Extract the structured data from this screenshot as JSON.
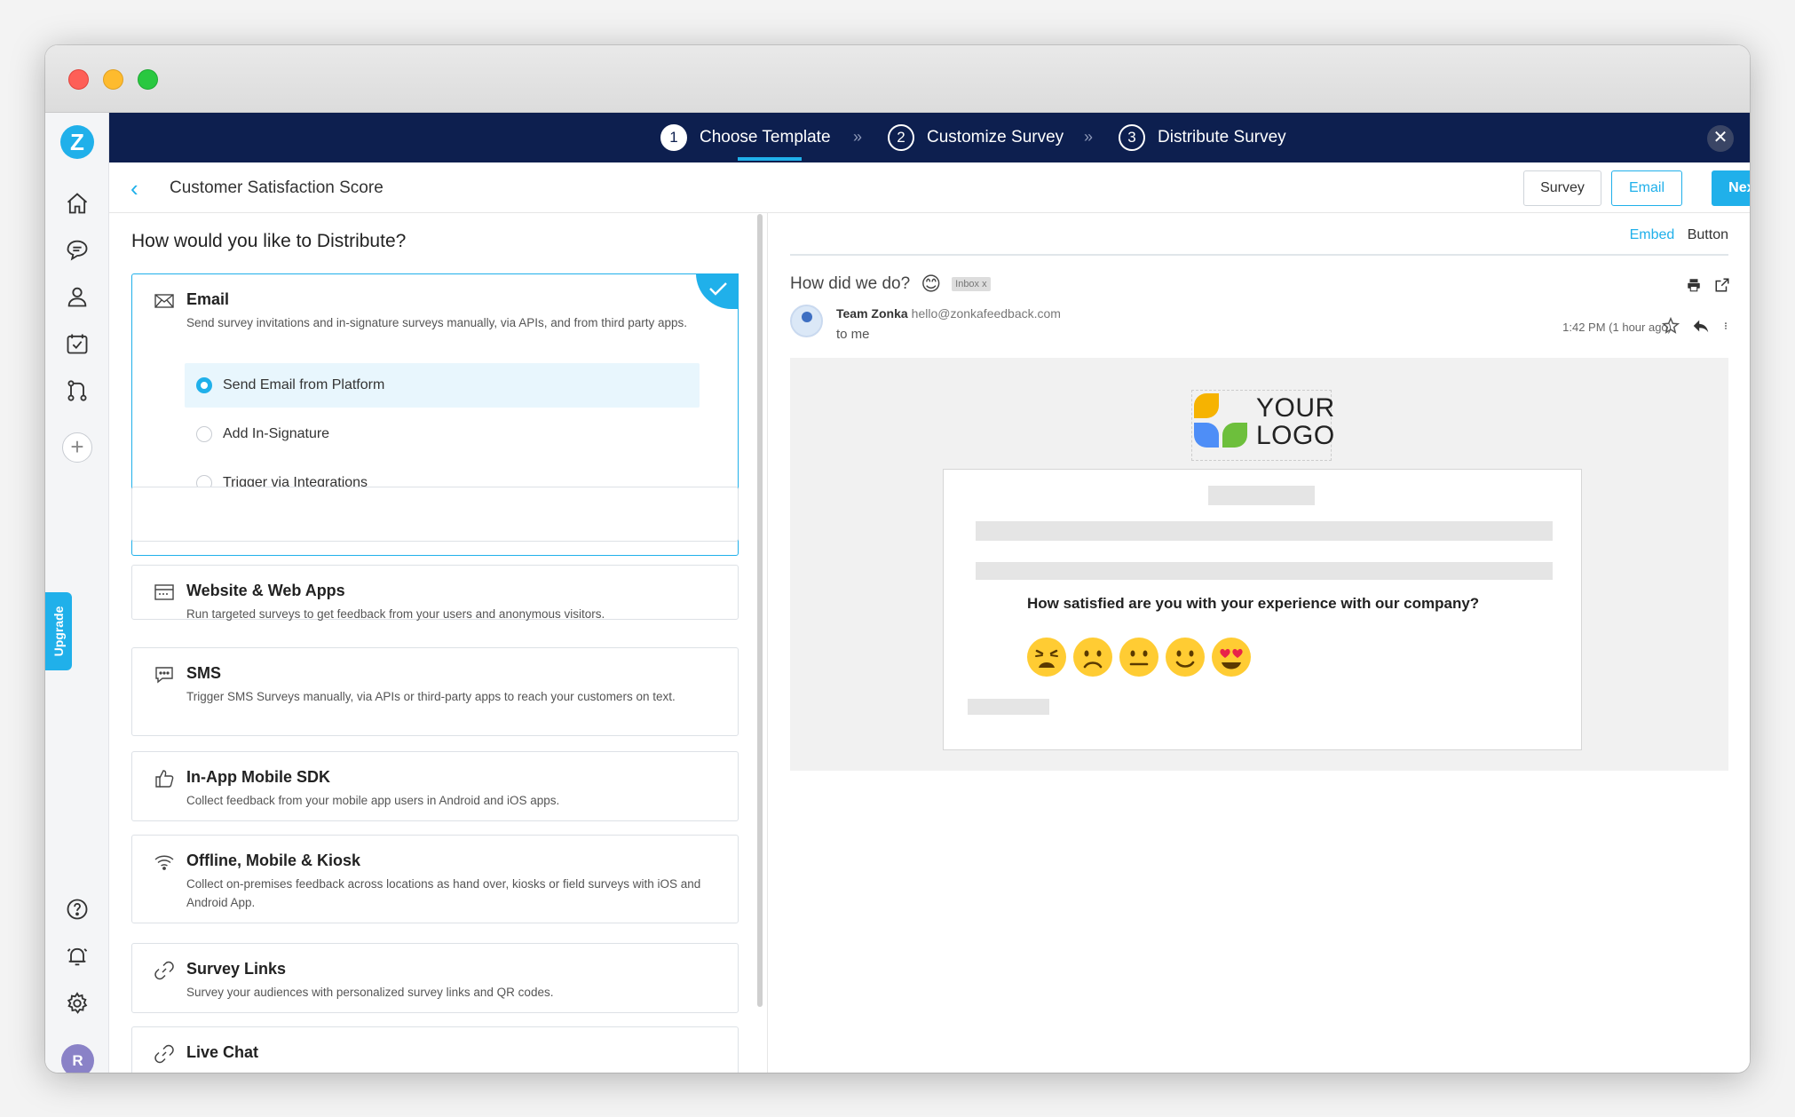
{
  "steps": [
    {
      "num": "1",
      "label": "Choose Template"
    },
    {
      "num": "2",
      "label": "Customize Survey"
    },
    {
      "num": "3",
      "label": "Distribute Survey"
    }
  ],
  "step_separator": "»",
  "close_glyph": "✕",
  "header": {
    "title": "Customer Satisfaction Score",
    "back_glyph": "‹",
    "buttons": {
      "survey": "Survey",
      "email": "Email",
      "next": "Next"
    }
  },
  "sidebar": {
    "logo": "Z",
    "upgrade": "Upgrade",
    "avatar": "R",
    "plus": "+",
    "icons": [
      "home-icon",
      "chat-icon",
      "user-icon",
      "tasks-icon",
      "workflow-icon",
      "help-icon",
      "bell-icon",
      "settings-icon"
    ]
  },
  "distribute": {
    "question": "How would you like to Distribute?",
    "email": {
      "title": "Email",
      "desc": "Send survey invitations and in-signature surveys manually, via APIs, and from third party apps.",
      "options": [
        "Send Email from Platform",
        "Add In-Signature",
        "Trigger via Integrations"
      ]
    },
    "channels": [
      {
        "title": "Website & Web Apps",
        "desc": "Run targeted surveys to get feedback from your users and anonymous visitors."
      },
      {
        "title": "SMS",
        "desc": "Trigger SMS Surveys manually, via APIs or third-party apps to reach your customers on text."
      },
      {
        "title": "In-App Mobile SDK",
        "desc": "Collect feedback from your mobile app users in Android and iOS apps."
      },
      {
        "title": "Offline, Mobile & Kiosk",
        "desc": "Collect on-premises feedback across locations as hand over, kiosks or field surveys with iOS and Android App."
      },
      {
        "title": "Survey Links",
        "desc": "Survey your audiences with personalized survey links and QR codes."
      },
      {
        "title": "Live Chat",
        "desc": ""
      }
    ]
  },
  "preview": {
    "tabs": {
      "embed": "Embed",
      "button": "Button"
    },
    "subject": "How did we do?",
    "subject_emoji": "😊",
    "inbox_badge": "Inbox x",
    "sender_name": "Team Zonka",
    "sender_email": "hello@zonkafeedback.com",
    "to": "to me",
    "time": "1:42 PM (1 hour ago)",
    "logo_text_1": "YOUR",
    "logo_text_2": "LOGO",
    "survey_question": "How satisfied are you with your experience with our company?",
    "emojis": [
      "😫",
      "☹️",
      "😐",
      "🙂",
      "😍"
    ]
  },
  "colors": {
    "accent": "#20b0ea",
    "navy": "#0d1f4f"
  }
}
